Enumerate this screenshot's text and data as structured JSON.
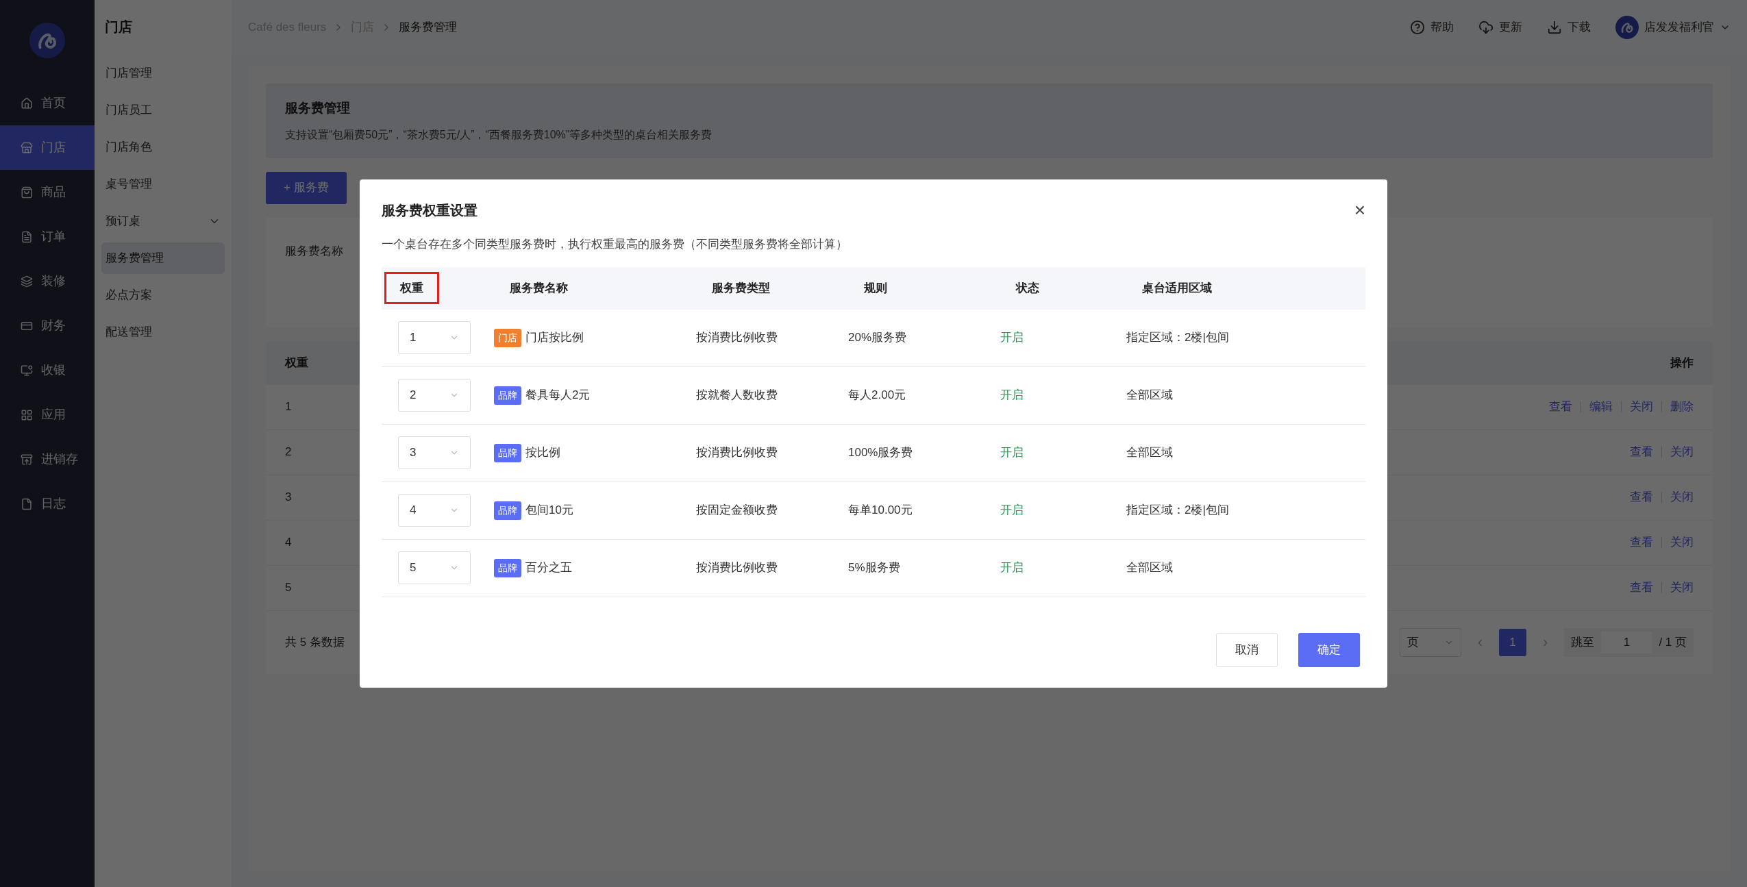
{
  "sidebar": {
    "items": [
      {
        "label": "首页",
        "selected": false
      },
      {
        "label": "门店",
        "selected": true
      },
      {
        "label": "商品",
        "selected": false
      },
      {
        "label": "订单",
        "selected": false
      },
      {
        "label": "装修",
        "selected": false
      },
      {
        "label": "财务",
        "selected": false
      },
      {
        "label": "收银",
        "selected": false
      },
      {
        "label": "应用",
        "selected": false
      },
      {
        "label": "进销存",
        "selected": false
      },
      {
        "label": "日志",
        "selected": false
      }
    ]
  },
  "submenu": {
    "title": "门店",
    "items": [
      {
        "label": "门店管理",
        "selected": false,
        "expandable": false
      },
      {
        "label": "门店员工",
        "selected": false,
        "expandable": false
      },
      {
        "label": "门店角色",
        "selected": false,
        "expandable": false
      },
      {
        "label": "桌号管理",
        "selected": false,
        "expandable": false
      },
      {
        "label": "预订桌",
        "selected": false,
        "expandable": true
      },
      {
        "label": "服务费管理",
        "selected": true,
        "expandable": false
      },
      {
        "label": "必点方案",
        "selected": false,
        "expandable": false
      },
      {
        "label": "配送管理",
        "selected": false,
        "expandable": false
      }
    ]
  },
  "topbar": {
    "breadcrumb": [
      "Café des fleurs",
      "门店",
      "服务费管理"
    ],
    "actions": [
      "帮助",
      "更新",
      "下载"
    ],
    "user": "店发发福利官"
  },
  "banner": {
    "title": "服务费管理",
    "description": "支持设置“包厢费50元”，“茶水费5元/人”，“西餐服务费10%”等多种类型的桌台相关服务费"
  },
  "add_button": "+ 服务费",
  "filter": {
    "label": "服务费名称"
  },
  "table": {
    "columns": [
      "权重",
      "操作"
    ],
    "rows": [
      {
        "weight": "1",
        "actions": [
          "查看",
          "编辑",
          "关闭",
          "删除"
        ]
      },
      {
        "weight": "2",
        "actions": [
          "查看",
          "关闭"
        ]
      },
      {
        "weight": "3",
        "actions": [
          "查看",
          "关闭"
        ]
      },
      {
        "weight": "4",
        "actions": [
          "查看",
          "关闭"
        ]
      },
      {
        "weight": "5",
        "actions": [
          "查看",
          "关闭"
        ]
      }
    ]
  },
  "footer": {
    "total": "共 5 条数据",
    "page_size": "页",
    "prev": "‹",
    "next": "›",
    "pages": [
      {
        "label": "1",
        "selected": true
      }
    ],
    "jump_label": "跳至",
    "jump_value": "1",
    "page_total": "/ 1 页"
  },
  "modal": {
    "title": "服务费权重设置",
    "close": "×",
    "description": "一个桌台存在多个同类型服务费时，执行权重最高的服务费（不同类型服务费将全部计算）",
    "columns": [
      {
        "label": "权重",
        "highlighted": true
      },
      {
        "label": "服务费名称",
        "highlighted": false
      },
      {
        "label": "服务费类型",
        "highlighted": false
      },
      {
        "label": "规则",
        "highlighted": false
      },
      {
        "label": "状态",
        "highlighted": false
      },
      {
        "label": "桌台适用区域",
        "highlighted": false
      }
    ],
    "rows": [
      {
        "weight": "1",
        "tag": {
          "label": "门店",
          "color": "#f0802d"
        },
        "name": "门店按比例",
        "type": "按消费比例收费",
        "rule": "20%服务费",
        "status": "开启",
        "enabled": true,
        "area": "指定区域：2楼|包间"
      },
      {
        "weight": "2",
        "tag": {
          "label": "品牌",
          "color": "#5b6cf5"
        },
        "name": "餐具每人2元",
        "type": "按就餐人数收费",
        "rule": "每人2.00元",
        "status": "开启",
        "enabled": true,
        "area": "全部区域"
      },
      {
        "weight": "3",
        "tag": {
          "label": "品牌",
          "color": "#5b6cf5"
        },
        "name": "按比例",
        "type": "按消费比例收费",
        "rule": "100%服务费",
        "status": "开启",
        "enabled": true,
        "area": "全部区域"
      },
      {
        "weight": "4",
        "tag": {
          "label": "品牌",
          "color": "#5b6cf5"
        },
        "name": "包间10元",
        "type": "按固定金额收费",
        "rule": "每单10.00元",
        "status": "开启",
        "enabled": true,
        "area": "指定区域：2楼|包间"
      },
      {
        "weight": "5",
        "tag": {
          "label": "品牌",
          "color": "#5b6cf5"
        },
        "name": "百分之五",
        "type": "按消费比例收费",
        "rule": "5%服务费",
        "status": "开启",
        "enabled": true,
        "area": "全部区域"
      }
    ],
    "buttons": [
      {
        "label": "取消",
        "kind": "secondary"
      },
      {
        "label": "确定",
        "kind": "primary"
      }
    ]
  }
}
